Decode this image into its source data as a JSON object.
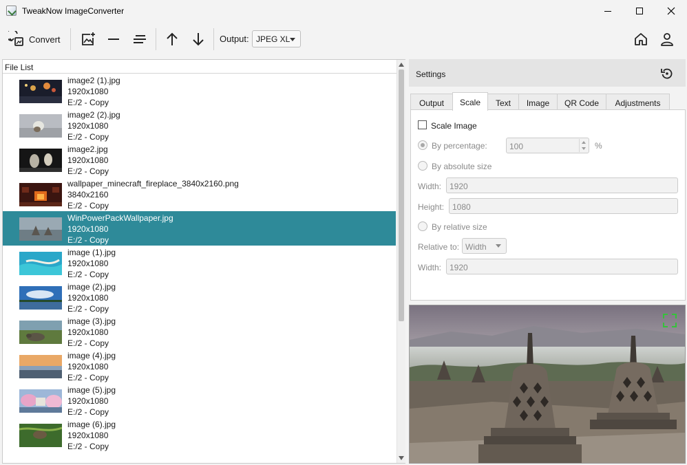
{
  "window": {
    "title": "TweakNow ImageConverter"
  },
  "toolbar": {
    "convert_label": "Convert",
    "output_label": "Output:",
    "output_value": "JPEG XL"
  },
  "file_list": {
    "header": "File List",
    "files": [
      {
        "name": "image2 (1).jpg",
        "size": "1920x1080",
        "location": "E:/2 - Copy"
      },
      {
        "name": "image2 (2).jpg",
        "size": "1920x1080",
        "location": "E:/2 - Copy"
      },
      {
        "name": "image2.jpg",
        "size": "1920x1080",
        "location": "E:/2 - Copy"
      },
      {
        "name": "wallpaper_minecraft_fireplace_3840x2160.png",
        "size": "3840x2160",
        "location": "E:/2 - Copy"
      },
      {
        "name": "WinPowerPackWallpaper.jpg",
        "size": "1920x1080",
        "location": "E:/2 - Copy"
      },
      {
        "name": "image (1).jpg",
        "size": "1920x1080",
        "location": "E:/2 - Copy"
      },
      {
        "name": "image (2).jpg",
        "size": "1920x1080",
        "location": "E:/2 - Copy"
      },
      {
        "name": "image (3).jpg",
        "size": "1920x1080",
        "location": "E:/2 - Copy"
      },
      {
        "name": "image (4).jpg",
        "size": "1920x1080",
        "location": "E:/2 - Copy"
      },
      {
        "name": "image (5).jpg",
        "size": "1920x1080",
        "location": "E:/2 - Copy"
      },
      {
        "name": "image (6).jpg",
        "size": "1920x1080",
        "location": "E:/2 - Copy"
      }
    ]
  },
  "settings": {
    "title": "Settings",
    "tabs": [
      "Output",
      "Scale",
      "Text",
      "Image",
      "QR Code",
      "Adjustments"
    ],
    "active_tab": "Scale",
    "scale": {
      "scale_image_label": "Scale Image",
      "by_percentage_label": "By percentage:",
      "percentage_value": "100",
      "percent_sign": "%",
      "by_absolute_label": "By absolute size",
      "width_label": "Width:",
      "width_value": "1920",
      "height_label": "Height:",
      "height_value": "1080",
      "by_relative_label": "By relative size",
      "relative_to_label": "Relative to:",
      "relative_to_value": "Width",
      "relative_width_label": "Width:",
      "relative_width_value": "1920"
    }
  },
  "colors": {
    "selection": "#2e8a99",
    "fullscreen_accent": "#35c23a"
  },
  "icons": {
    "convert": "convert-icon",
    "add_image": "add-image-icon",
    "remove": "minus-icon",
    "clear": "lines-icon",
    "move_up": "arrow-up-icon",
    "move_down": "arrow-down-icon",
    "home": "home-icon",
    "user": "user-icon",
    "reset": "reset-icon",
    "fullscreen": "fullscreen-icon"
  }
}
